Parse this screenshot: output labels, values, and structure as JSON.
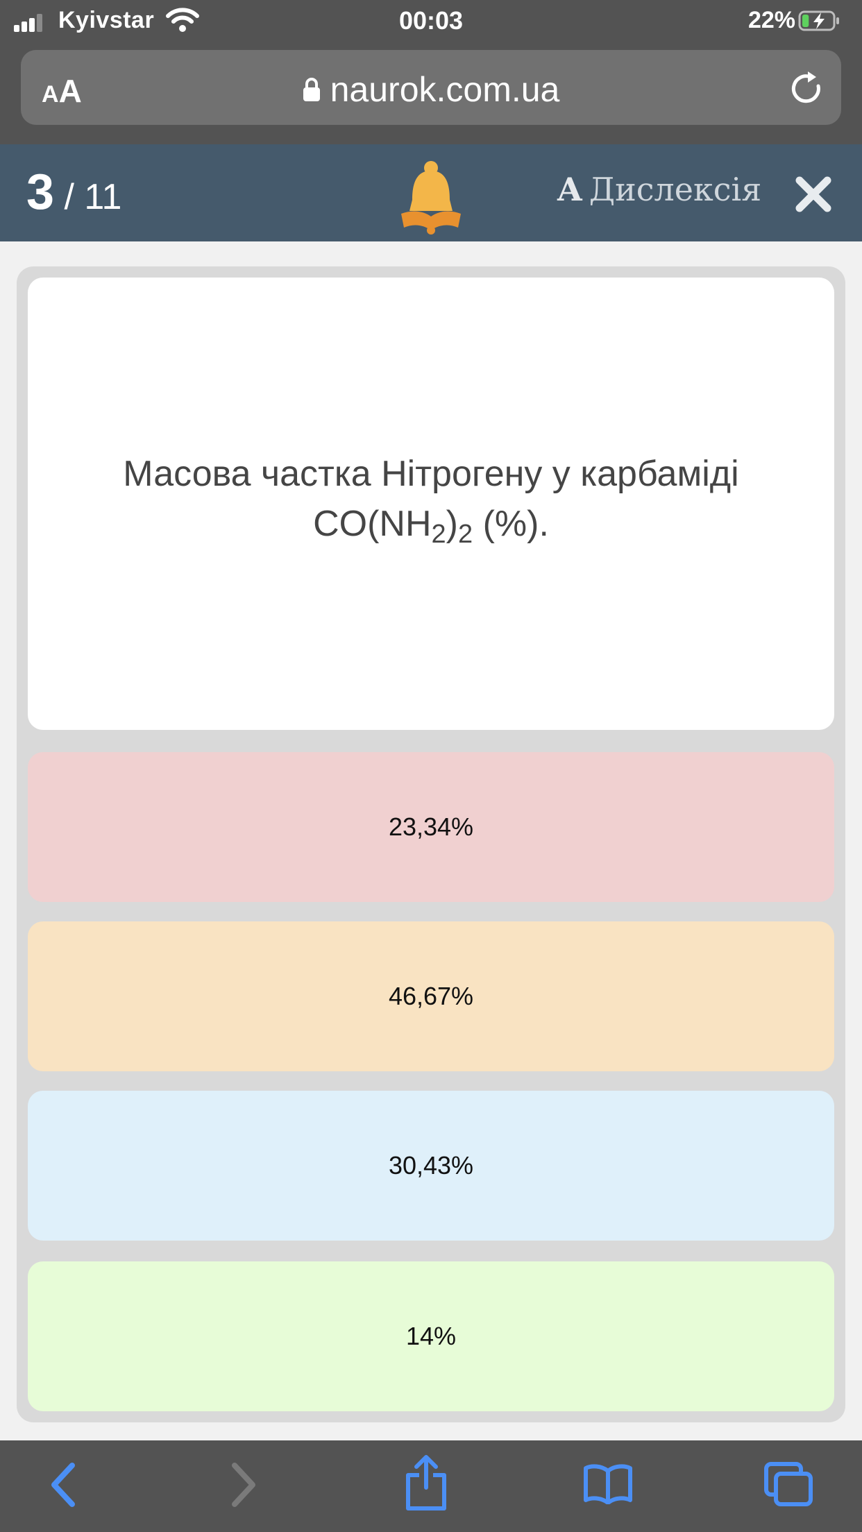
{
  "status_bar": {
    "carrier": "Kyivstar",
    "time": "00:03",
    "battery_percent": "22%",
    "battery_level": 0.22,
    "icons": [
      "signal-icon",
      "wifi-icon",
      "battery-charging-icon"
    ]
  },
  "browser": {
    "text_size_label_small": "A",
    "text_size_label_large": "A",
    "url": "naurok.com.ua",
    "icons": [
      "lock-icon",
      "reload-icon"
    ],
    "toolbar_icons": [
      "back-icon",
      "forward-icon",
      "share-icon",
      "bookmarks-icon",
      "tabs-icon"
    ]
  },
  "quiz_header": {
    "current_question": "3",
    "total_questions": "/ 11",
    "dyslexia_glyph": "A",
    "dyslexia_label": "Дислексія",
    "icons": [
      "bell-logo-icon",
      "close-icon"
    ],
    "colors": {
      "header_bg": "#455a6c",
      "bell": "#f3b649",
      "book": "#e8912f"
    }
  },
  "question": {
    "text_prefix": "Масова частка Нітрогену у карбаміді",
    "formula_part1": "CO(NH",
    "formula_sub1": "2",
    "formula_part2": ")",
    "formula_sub2": "2",
    "formula_suffix": " (%)."
  },
  "answers": [
    {
      "label": "23,34%",
      "color": "#f0d0d0"
    },
    {
      "label": "46,67%",
      "color": "#f9e3c2"
    },
    {
      "label": "30,43%",
      "color": "#dff0fa"
    },
    {
      "label": "14%",
      "color": "#e7fcd7"
    }
  ]
}
